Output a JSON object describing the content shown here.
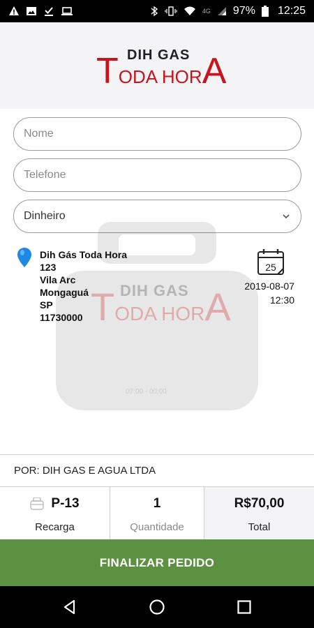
{
  "status_bar": {
    "network_label": "4G",
    "battery": "97%",
    "time": "12:25",
    "icons_left": [
      "alert-icon",
      "image-icon",
      "download-done-icon",
      "laptop-icon"
    ],
    "icons_right": [
      "bluetooth-icon",
      "vibrate-icon",
      "wifi-icon",
      "signal-icon",
      "battery-icon"
    ]
  },
  "logo": {
    "line1": "DIH GAS",
    "big1": "T",
    "mid1": "ODA HOR",
    "big2": "A"
  },
  "form": {
    "name_placeholder": "Nome",
    "phone_placeholder": "Telefone",
    "payment_selected": "Dinheiro"
  },
  "store": {
    "name": "Dih Gás Toda Hora",
    "number": "123",
    "district": "Vila Arc",
    "city": "Mongaguá",
    "state": "SP",
    "zip": "11730000",
    "calendar_day": "25",
    "date": "2019-08-07",
    "time": "12:30"
  },
  "watermark": {
    "line1": "DIH GAS",
    "big1": "T",
    "mid1": "ODA HOR",
    "big2": "A",
    "hours": "07:00 - 00:00"
  },
  "seller": "POR: DIH GAS E AGUA LTDA",
  "summary": {
    "product": "P-13",
    "product_type": "Recarga",
    "quantity": "1",
    "quantity_label": "Quantidade",
    "total": "R$70,00",
    "total_label": "Total"
  },
  "action": {
    "finalize_label": "FINALIZAR PEDIDO"
  },
  "colors": {
    "brand_red": "#c8141b",
    "action_green": "#5b9140",
    "pin_blue": "#1e88e5"
  }
}
